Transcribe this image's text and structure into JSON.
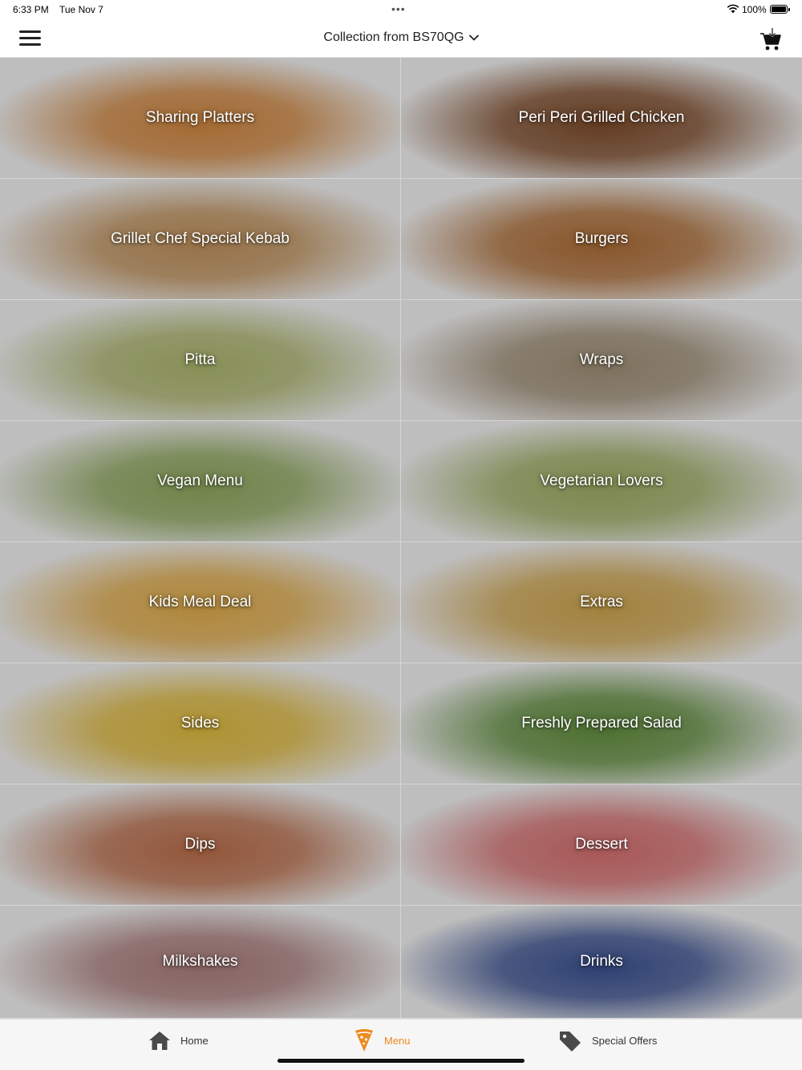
{
  "status_bar": {
    "time": "6:33 PM",
    "date": "Tue Nov 7",
    "more_dots": "•••",
    "battery_percent": "100%",
    "battery_level": 1.0
  },
  "header": {
    "location_label": "Collection from BS70QG",
    "menu_icon": "hamburger-icon",
    "cart_icon": "shopping-cart-icon",
    "dropdown_icon": "chevron-down-icon"
  },
  "categories": [
    {
      "label": "Sharing Platters",
      "color": "#c9823e"
    },
    {
      "label": "Peri Peri Grilled Chicken",
      "color": "#7a4a2a"
    },
    {
      "label": "Grillet Chef Special Kebab",
      "color": "#b98c58"
    },
    {
      "label": "Burgers",
      "color": "#a86a35"
    },
    {
      "label": "Pitta",
      "color": "#a7b06a"
    },
    {
      "label": "Wraps",
      "color": "#9a8a72"
    },
    {
      "label": "Vegan Menu",
      "color": "#8aa25a"
    },
    {
      "label": "Vegetarian Lovers",
      "color": "#98a860"
    },
    {
      "label": "Kids Meal Deal",
      "color": "#d8a648"
    },
    {
      "label": "Extras",
      "color": "#c8a04c"
    },
    {
      "label": "Sides",
      "color": "#d7b33c"
    },
    {
      "label": "Freshly Prepared Salad",
      "color": "#5f8a3d"
    },
    {
      "label": "Dips",
      "color": "#b46a48"
    },
    {
      "label": "Dessert",
      "color": "#cf6b6b"
    },
    {
      "label": "Milkshakes",
      "color": "#a57a78"
    },
    {
      "label": "Drinks",
      "color": "#3a4f8c"
    }
  ],
  "tab_bar": {
    "home_label": "Home",
    "menu_label": "Menu",
    "offers_label": "Special Offers",
    "active_color": "#ee8a1f"
  }
}
